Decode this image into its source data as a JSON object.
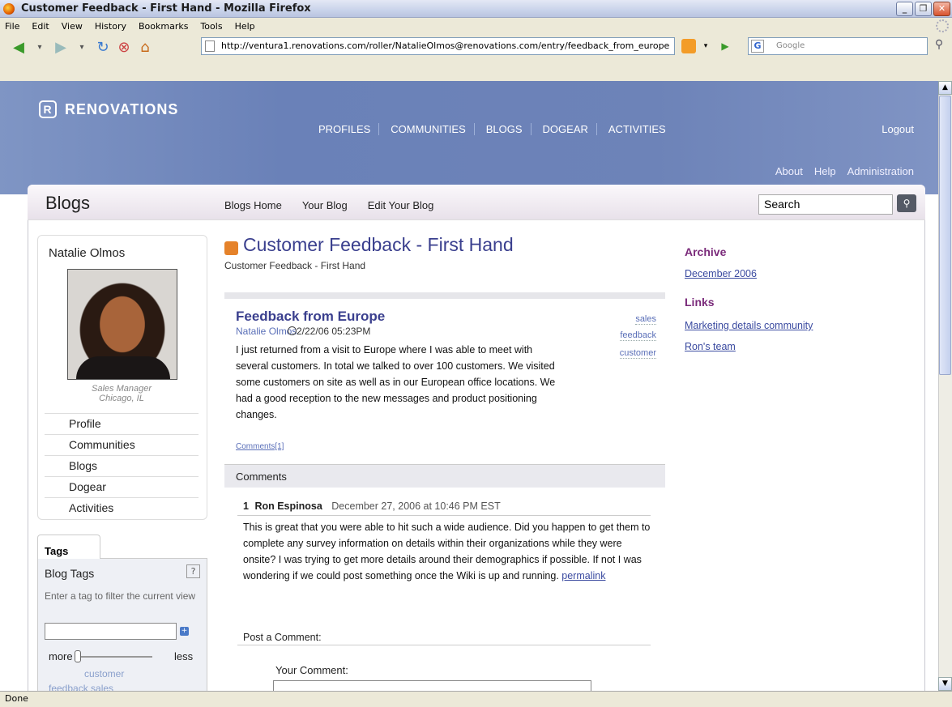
{
  "window": {
    "title": "Customer Feedback - First Hand - Mozilla Firefox"
  },
  "menu": [
    "File",
    "Edit",
    "View",
    "History",
    "Bookmarks",
    "Tools",
    "Help"
  ],
  "address": {
    "url": "http://ventura1.renovations.com/roller/NatalieOlmos@renovations.com/entry/feedback_from_europe"
  },
  "websearch": {
    "placeholder": "Google"
  },
  "site": {
    "logo": "RENOVATIONS",
    "nav": [
      "PROFILES",
      "COMMUNITIES",
      "BLOGS",
      "DOGEAR",
      "ACTIVITIES"
    ],
    "logout": "Logout",
    "util": [
      "About",
      "Help",
      "Administration"
    ]
  },
  "blogs": {
    "title": "Blogs",
    "subnav": [
      "Blogs Home",
      "Your Blog",
      "Edit Your Blog"
    ],
    "search": "Search"
  },
  "profile": {
    "name": "Natalie Olmos",
    "role": "Sales Manager",
    "location": "Chicago, IL",
    "links": [
      "Profile",
      "Communities",
      "Blogs",
      "Dogear",
      "Activities"
    ]
  },
  "tags": {
    "tab": "Tags",
    "heading": "Blog Tags",
    "help": "?",
    "tip": "Enter a tag to filter the current view",
    "more": "more",
    "less": "less",
    "cloud": [
      "customer",
      "feedback  sales"
    ]
  },
  "blog": {
    "title": "Customer Feedback - First Hand",
    "subtitle": "Customer Feedback - First Hand"
  },
  "entry": {
    "title": "Feedback from Europe",
    "author": "Natalie Olmos",
    "date": "2/22/06 05:23PM",
    "body": "I just returned from a visit to Europe where I was able to meet with several customers.  In total we talked to over 100 customers.  We visited some customers on site as well as in our European office locations.  We had a good reception to the new messages and product positioning changes.",
    "tags": [
      "sales",
      "feedback",
      "customer"
    ],
    "comments_link": "Comments[1]"
  },
  "comments": {
    "heading": "Comments",
    "items": [
      {
        "num": "1",
        "author": "Ron Espinosa",
        "date": "December 27, 2006 at 10:46 PM EST",
        "text": "This is great that you were able to hit such a wide audience. Did you happen to get them to complete any survey information on details within their organizations while they were onsite? I was trying to get more details around their demographics if possible. If not I was wondering if we could post something once the Wiki is up and running. ",
        "permalink": "permalink"
      }
    ],
    "post_label": "Post a Comment:",
    "your_comment": "Your Comment:"
  },
  "sidebar": {
    "archive_title": "Archive",
    "archive": [
      "December 2006"
    ],
    "links_title": "Links",
    "links": [
      "Marketing details community",
      "Ron's team"
    ]
  },
  "status": "Done"
}
